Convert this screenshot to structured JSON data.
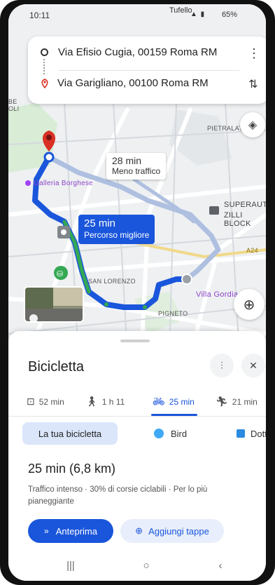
{
  "status_bar": {
    "time": "10:11",
    "carrier": "Tufello",
    "battery": "65%"
  },
  "route": {
    "origin": "Via Efisio Cugia, 00159 Roma RM",
    "destination": "Via Garigliano, 00100 Roma RM"
  },
  "map": {
    "labels": {
      "galleria": "Galleria Borghese",
      "pietralata": "PIETRALATA",
      "superauto": "SUPERAUTO",
      "zilli": "ZILLI BLOCK",
      "san_lorenzo": "SAN LORENZO",
      "villa": "Villa Gordia",
      "pigneto": "PIGNETO",
      "a24": "A24",
      "edge": "BE\nOLI"
    },
    "alt_route": {
      "time": "28 min",
      "note": "Meno traffico"
    },
    "best_route": {
      "time": "25 min",
      "note": "Percorso migliore"
    },
    "colors": {
      "route_primary": "#1a56db",
      "route_alt": "#aebfe0",
      "bike_lane": "#34a853",
      "destination_pin": "#d93025"
    }
  },
  "sheet": {
    "title": "Bicicletta",
    "modes": [
      {
        "icon": "car-icon",
        "label": "52 min"
      },
      {
        "icon": "walk-icon",
        "label": "1 h 11"
      },
      {
        "icon": "bike-icon",
        "label": "25 min",
        "active": true
      },
      {
        "icon": "run-icon",
        "label": "21 min"
      }
    ],
    "providers": {
      "selected": "La tua bicicletta",
      "bird": "Bird",
      "dott": "Dott"
    },
    "duration": "25 min (6,8 km)",
    "description": "Traffico intenso · 30% di corsie ciclabili · Per lo più pianeggiante",
    "buttons": {
      "preview": "Anteprima",
      "add_stops": "Aggiungi tappe"
    }
  }
}
